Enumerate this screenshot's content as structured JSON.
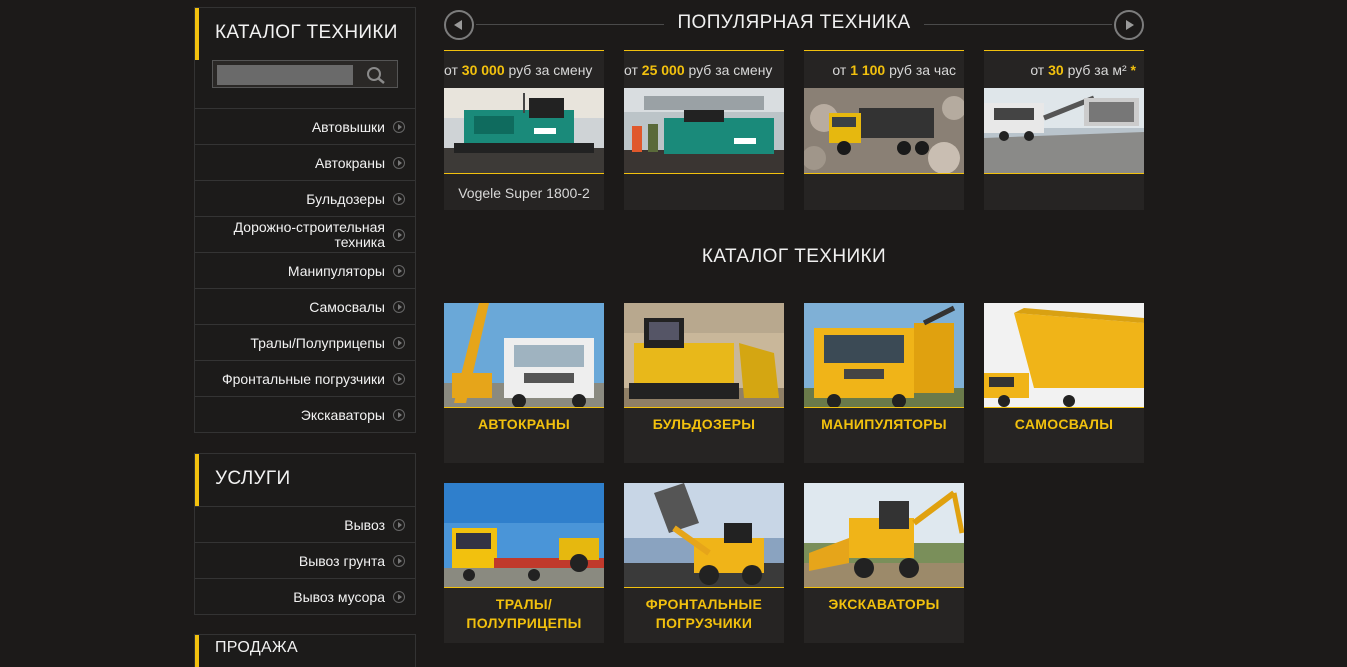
{
  "sidebar": {
    "catalog": {
      "title": "КАТАЛОГ ТЕХНИКИ",
      "search": {
        "value": "",
        "placeholder": ""
      },
      "items": [
        {
          "label": "Автовышки"
        },
        {
          "label": "Автокраны"
        },
        {
          "label": "Бульдозеры"
        },
        {
          "label": "Дорожно-строительная техника"
        },
        {
          "label": "Манипуляторы"
        },
        {
          "label": "Самосвалы"
        },
        {
          "label": "Тралы/Полуприцепы"
        },
        {
          "label": "Фронтальные погрузчики"
        },
        {
          "label": "Экскаваторы"
        }
      ]
    },
    "services": {
      "title": "УСЛУГИ",
      "items": [
        {
          "label": "Вывоз"
        },
        {
          "label": "Вывоз грунта"
        },
        {
          "label": "Вывоз мусора"
        }
      ]
    },
    "sales": {
      "title": "ПРОДАЖА"
    }
  },
  "popular": {
    "title": "ПОПУЛЯРНАЯ ТЕХНИКА",
    "cards": [
      {
        "prefix": "от ",
        "amount": "30 000",
        "suffix": " руб за смену",
        "name": "Vogele Super 1800-2"
      },
      {
        "prefix": "от ",
        "amount": "25 000",
        "suffix": " руб за смену",
        "name": ""
      },
      {
        "prefix": "от ",
        "amount": "1 100",
        "suffix": " руб за час",
        "name": ""
      },
      {
        "prefix": "от ",
        "amount": "30",
        "suffix": " руб за м² ",
        "star": "*",
        "name": ""
      }
    ]
  },
  "catalog": {
    "title": "КАТАЛОГ ТЕХНИКИ",
    "cards": [
      {
        "line1": "АВТОКРАНЫ",
        "line2": ""
      },
      {
        "line1": "БУЛЬДОЗЕРЫ",
        "line2": ""
      },
      {
        "line1": "МАНИПУЛЯТОРЫ",
        "line2": ""
      },
      {
        "line1": "САМОСВАЛЫ",
        "line2": ""
      },
      {
        "line1": "ТРАЛЫ/",
        "line2": "ПОЛУПРИЦЕПЫ"
      },
      {
        "line1": "ФРОНТАЛЬНЫЕ",
        "line2": "ПОГРУЗЧИКИ"
      },
      {
        "line1": "ЭКСКАВАТОРЫ",
        "line2": ""
      }
    ]
  },
  "colors": {
    "accent": "#f2c10e",
    "background": "#1c1a19",
    "card": "#262423"
  }
}
